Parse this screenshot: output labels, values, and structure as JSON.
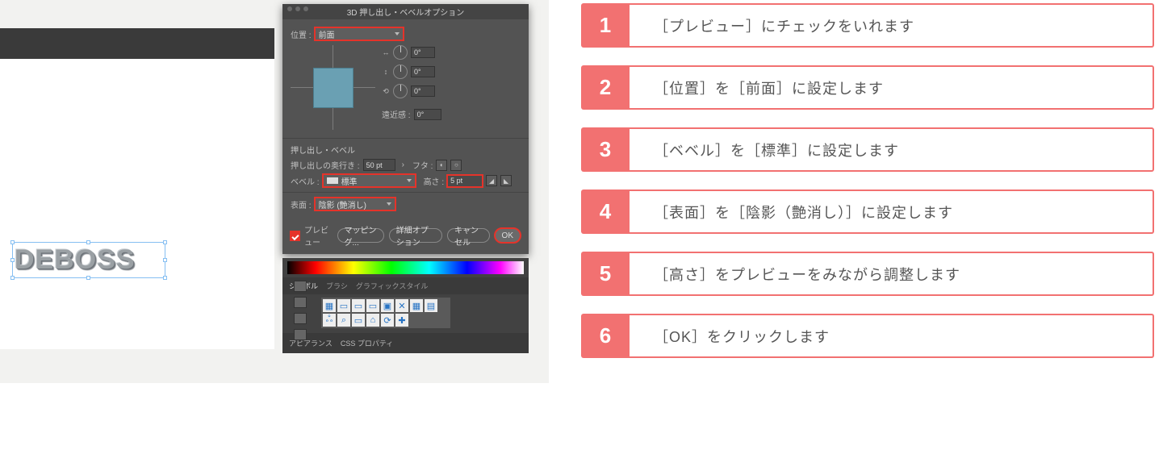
{
  "dialog": {
    "title": "3D 押し出し・ベベルオプション",
    "position_label": "位置 :",
    "position_value": "前面",
    "angles": {
      "x": "0°",
      "y": "0°",
      "z": "0°"
    },
    "perspective_label": "遠近感 :",
    "perspective_value": "0°",
    "section_title": "押し出し・ベベル",
    "depth_label": "押し出しの奥行き :",
    "depth_value": "50 pt",
    "cap_label": "フタ :",
    "bevel_label": "ベベル :",
    "bevel_value": "標準",
    "height_label": "高さ :",
    "height_value": "5 pt",
    "surface_label": "表面 :",
    "surface_value": "陰影 (艶消し)",
    "preview_label": "プレビュー",
    "mapping_btn": "マッピング...",
    "detail_btn": "詳細オプション",
    "cancel_btn": "キャンセル",
    "ok_btn": "OK"
  },
  "panel": {
    "tab_symbol": "シンボル",
    "tab_brush": "ブラシ",
    "tab_graphic": "グラフィックスタイル",
    "tab_appearance": "アピアランス",
    "tab_css": "CSS プロパティ",
    "symbols": [
      "▦",
      "▭",
      "▭",
      "▭",
      "▣",
      "✕",
      "▦",
      "▤",
      "ஃ",
      "⌕",
      "▭",
      "⌂",
      "⟳",
      "✚"
    ]
  },
  "deboss": "DEBOSS",
  "steps": [
    "［プレビュー］にチェックをいれます",
    "［位置］を［前面］に設定します",
    "［ベベル］を［標準］に設定します",
    "［表面］を［陰影（艶消し）］に設定します",
    "［高さ］をプレビューをみながら調整します",
    "［OK］をクリックします"
  ]
}
